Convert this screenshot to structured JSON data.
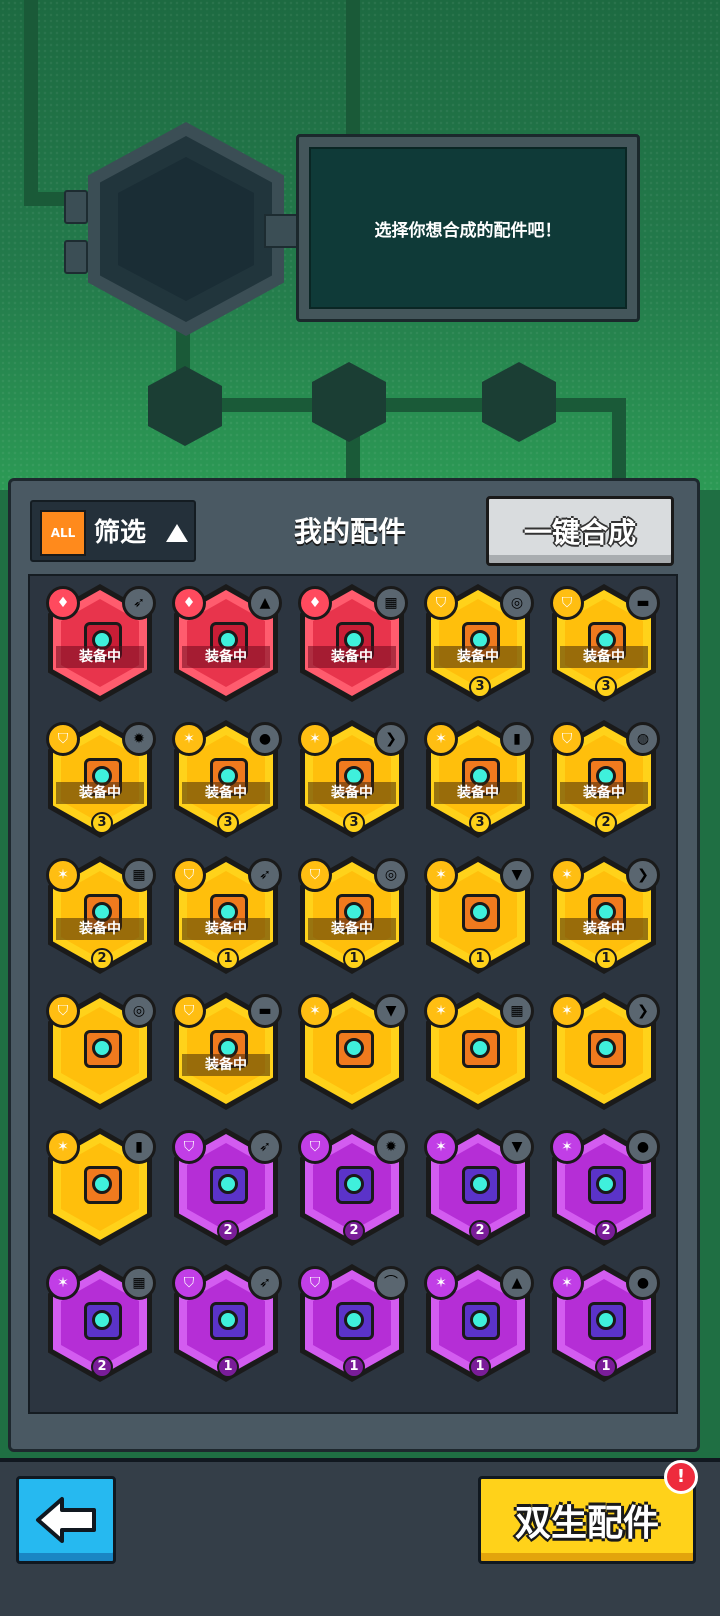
{
  "header": {
    "prompt": "选择你想合成的配件吧！"
  },
  "toolbar": {
    "filter_badge": "ALL",
    "filter_label": "筛选",
    "title": "我的配件",
    "merge_button": "一键合成"
  },
  "footer": {
    "twin_button": "双生配件",
    "alert": "!"
  },
  "colors": {
    "red": "#e8344c",
    "gold": "#ffbf0c",
    "purple": "#b52ed6",
    "back": "#26b9f0",
    "twin": "#ffd21a"
  },
  "items": [
    {
      "rarity": "red",
      "type_icon": "shield-crest-icon",
      "weapon_icon": "rocket-icon",
      "equipped": "装备中",
      "level": ""
    },
    {
      "rarity": "red",
      "type_icon": "shield-crest-icon",
      "weapon_icon": "drill-cone-icon",
      "equipped": "装备中",
      "level": ""
    },
    {
      "rarity": "red",
      "type_icon": "shield-crest-icon",
      "weapon_icon": "gear-box-icon",
      "equipped": "装备中",
      "level": ""
    },
    {
      "rarity": "gold",
      "type_icon": "shield-icon",
      "weapon_icon": "target-disc-icon",
      "equipped": "装备中",
      "level": "3"
    },
    {
      "rarity": "gold",
      "type_icon": "shield-icon",
      "weapon_icon": "brick-icon",
      "equipped": "装备中",
      "level": "3"
    },
    {
      "rarity": "gold",
      "type_icon": "shield-icon",
      "weapon_icon": "virus-icon",
      "equipped": "装备中",
      "level": "3"
    },
    {
      "rarity": "gold",
      "type_icon": "claw-icon",
      "weapon_icon": "soccer-ball-icon",
      "equipped": "装备中",
      "level": "3"
    },
    {
      "rarity": "gold",
      "type_icon": "claw-icon",
      "weapon_icon": "boomerang-icon",
      "equipped": "装备中",
      "level": "3"
    },
    {
      "rarity": "gold",
      "type_icon": "claw-icon",
      "weapon_icon": "bottle-icon",
      "equipped": "装备中",
      "level": "3"
    },
    {
      "rarity": "gold",
      "type_icon": "shield-icon",
      "weapon_icon": "melon-icon",
      "equipped": "装备中",
      "level": "2"
    },
    {
      "rarity": "gold",
      "type_icon": "claw-icon",
      "weapon_icon": "gear-box-icon",
      "equipped": "装备中",
      "level": "2"
    },
    {
      "rarity": "gold",
      "type_icon": "shield-icon",
      "weapon_icon": "rocket-icon",
      "equipped": "装备中",
      "level": "1"
    },
    {
      "rarity": "gold",
      "type_icon": "shield-icon",
      "weapon_icon": "target-disc-icon",
      "equipped": "装备中",
      "level": "1"
    },
    {
      "rarity": "gold",
      "type_icon": "claw-icon",
      "weapon_icon": "drill-icon",
      "equipped": "",
      "level": "1"
    },
    {
      "rarity": "gold",
      "type_icon": "claw-icon",
      "weapon_icon": "boomerang-icon",
      "equipped": "装备中",
      "level": "1"
    },
    {
      "rarity": "gold",
      "type_icon": "shield-icon",
      "weapon_icon": "target-disc-icon",
      "equipped": "",
      "level": ""
    },
    {
      "rarity": "gold",
      "type_icon": "shield-icon",
      "weapon_icon": "brick-icon",
      "equipped": "装备中",
      "level": ""
    },
    {
      "rarity": "gold",
      "type_icon": "claw-icon",
      "weapon_icon": "drill-icon",
      "equipped": "",
      "level": ""
    },
    {
      "rarity": "gold",
      "type_icon": "claw-icon",
      "weapon_icon": "gear-box-icon",
      "equipped": "",
      "level": ""
    },
    {
      "rarity": "gold",
      "type_icon": "claw-icon",
      "weapon_icon": "boomerang-icon",
      "equipped": "",
      "level": ""
    },
    {
      "rarity": "gold",
      "type_icon": "claw-icon",
      "weapon_icon": "bottle-icon",
      "equipped": "",
      "level": ""
    },
    {
      "rarity": "purple",
      "type_icon": "shield-icon",
      "weapon_icon": "rocket-icon",
      "equipped": "",
      "level": "2"
    },
    {
      "rarity": "purple",
      "type_icon": "shield-icon",
      "weapon_icon": "virus-icon",
      "equipped": "",
      "level": "2"
    },
    {
      "rarity": "purple",
      "type_icon": "claw-icon",
      "weapon_icon": "drill-icon",
      "equipped": "",
      "level": "2"
    },
    {
      "rarity": "purple",
      "type_icon": "claw-icon",
      "weapon_icon": "soccer-ball-icon",
      "equipped": "",
      "level": "2"
    },
    {
      "rarity": "purple",
      "type_icon": "claw-icon",
      "weapon_icon": "gear-box-icon",
      "equipped": "",
      "level": "2"
    },
    {
      "rarity": "purple",
      "type_icon": "shield-icon",
      "weapon_icon": "rocket-icon",
      "equipped": "",
      "level": "1"
    },
    {
      "rarity": "purple",
      "type_icon": "shield-icon",
      "weapon_icon": "boomerang-arc-icon",
      "equipped": "",
      "level": "1"
    },
    {
      "rarity": "purple",
      "type_icon": "claw-icon",
      "weapon_icon": "drill-cone-icon",
      "equipped": "",
      "level": "1"
    },
    {
      "rarity": "purple",
      "type_icon": "claw-icon",
      "weapon_icon": "soccer-ball-icon",
      "equipped": "",
      "level": "1"
    }
  ]
}
